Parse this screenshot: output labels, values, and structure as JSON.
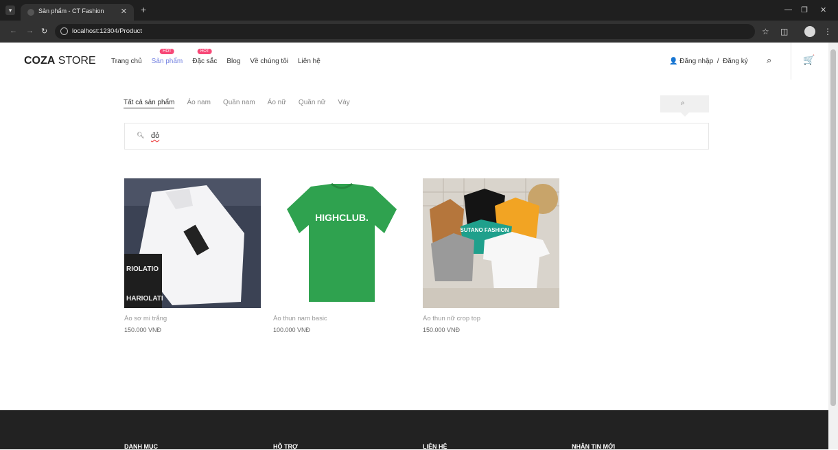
{
  "browser": {
    "tab_title": "Sản phẩm - CT Fashion",
    "url": "localhost:12304/Product"
  },
  "header": {
    "logo_bold": "COZA",
    "logo_rest": " STORE",
    "menu": [
      {
        "label": "Trang chủ",
        "hot": ""
      },
      {
        "label": "Sản phẩm",
        "hot": "HOT"
      },
      {
        "label": "Đặc sắc",
        "hot": "HOT"
      },
      {
        "label": "Blog",
        "hot": ""
      },
      {
        "label": "Về chúng tôi",
        "hot": ""
      },
      {
        "label": "Liên hệ",
        "hot": ""
      }
    ],
    "login": "Đăng nhập",
    "separator": "/",
    "register": "Đăng ký"
  },
  "filters": [
    "Tất cả sản phẩm",
    "Áo nam",
    "Quần nam",
    "Áo nữ",
    "Quần nữ",
    "Váy"
  ],
  "search": {
    "value": "đỏ"
  },
  "products": [
    {
      "name": "Áo sơ mi trắng",
      "price": "150.000 VNĐ",
      "image_text": "HARIOLATI"
    },
    {
      "name": "Áo thun nam basic",
      "price": "100.000 VNĐ",
      "image_text": "HIGHCLUB."
    },
    {
      "name": "Áo thun nữ crop top",
      "price": "150.000 VNĐ",
      "image_text": "SUTANO FASHION"
    }
  ],
  "footer": {
    "headings": [
      "DANH MỤC",
      "HỖ TRỢ",
      "LIÊN HỆ",
      "NHẬN TIN MỚI"
    ]
  },
  "colors": {
    "accent": "#717fe0",
    "hot_badge": "#f74877",
    "footer_bg": "#222222"
  }
}
